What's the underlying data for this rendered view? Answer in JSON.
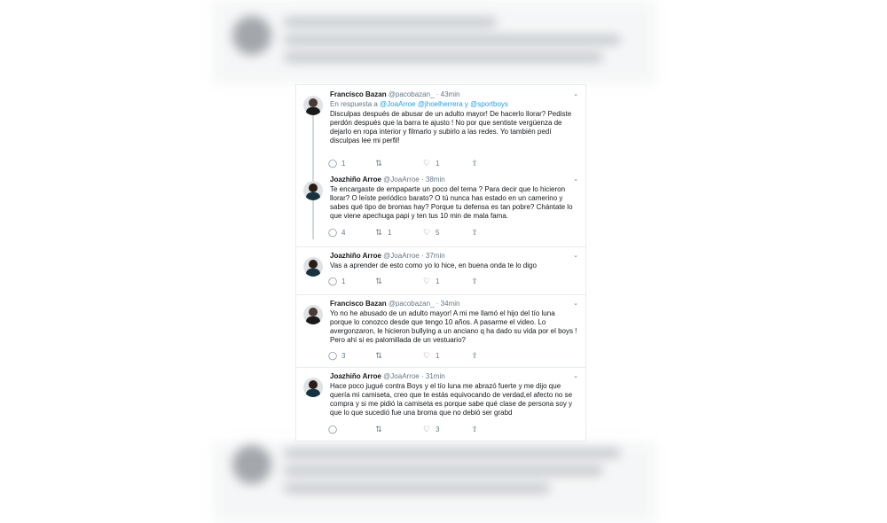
{
  "tweets": [
    {
      "name": "Francisco Bazan",
      "handle": "@pacobazan_",
      "time": "· 43min",
      "reply_prefix": "En respuesta a",
      "reply_mentions": "@JoaArroe @jhoelherrera y @sportboys",
      "text": "Disculpas después de abusar de un adulto mayor! De hacerlo llorar? Pediste perdón después que la barra te ajusto ! No por que sentiste vergüenza de dejarlo en ropa interior y filmarlo y subirlo a las redes. Yo también pedí disculpas lee mi perfil!",
      "replies": "1",
      "retweets": "",
      "likes": "1"
    },
    {
      "name": "Joazhiño Arroe",
      "handle": "@JoaArroe",
      "time": "· 38min",
      "text": "Te encargaste de empaparte un poco del tema ? Para decir que lo hicieron llorar? O leíste periódico barato? O tú nunca has estado en un camerino y sabes qué tipo de bromas hay? Porque tu defensa es tan pobre? Chántate lo que viene apechuga papi y ten tus 10 min de mala fama.",
      "replies": "4",
      "retweets": "1",
      "likes": "5"
    },
    {
      "name": "Joazhiño Arroe",
      "handle": "@JoaArroe",
      "time": "· 37min",
      "text": "Vas a aprender de esto como yo lo hice, en buena onda te lo digo",
      "replies": "1",
      "retweets": "",
      "likes": "1"
    },
    {
      "name": "Francisco Bazan",
      "handle": "@pacobazan_",
      "time": "· 34min",
      "text": "Yo no he abusado de un adulto mayor! A mi me llamó el hijo del tío luna porque lo conozco desde que tengo 10 años. A pasarme el video. Lo avergonzaron, le hicieron bullying a un anciano q ha dado su vida por el boys ! Pero ahí si es palomillada de un vestuario?",
      "replies": "3",
      "retweets": "",
      "likes": "1"
    },
    {
      "name": "Joazhiño Arroe",
      "handle": "@JoaArroe",
      "time": "· 31min",
      "text": "Hace poco jugué contra Boys y el tío luna me abrazó fuerte y me dijo que quería mi camiseta, creo que te estás equivocando de verdad,el afecto no se compra y si me pidió la camiseta es porque sabe qué clase de persona soy y que lo que sucedió fue una broma que no debió ser grabd",
      "replies": "",
      "retweets": "",
      "likes": "3"
    }
  ],
  "icons": {
    "reply": "reply-icon",
    "retweet": "retweet-icon",
    "like": "heart-icon",
    "share": "share-icon",
    "caret": "chevron-down-icon"
  },
  "colors": {
    "link": "#1da1f2",
    "text": "#14171a",
    "muted": "#657786"
  }
}
